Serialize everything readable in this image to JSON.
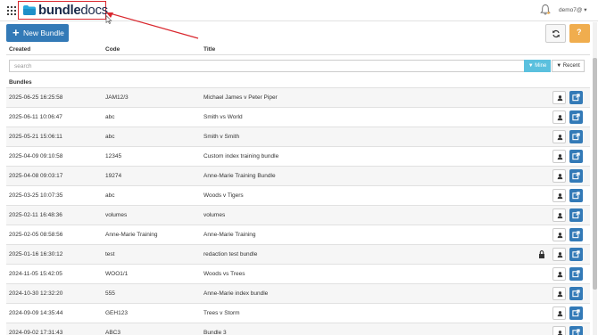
{
  "header": {
    "logo_bold": "bundle",
    "logo_light": "docs",
    "user": "demo7@ ▾"
  },
  "toolbar": {
    "new_bundle_label": "New Bundle",
    "new_bundle_icon": "plus-icon",
    "refresh_icon": "refresh-icon",
    "help_label": "?"
  },
  "columns": {
    "created": "Created",
    "code": "Code",
    "title": "Title"
  },
  "search": {
    "placeholder": "search",
    "value": "",
    "mine_label": "▼ Mine",
    "recent_label": "▼ Recent"
  },
  "section_label": "Bundles",
  "colors": {
    "primary": "#337ab7",
    "info": "#5bc0de",
    "warning": "#f0ad4e",
    "highlight": "#d9272e"
  },
  "bundles": [
    {
      "created": "2025-06-25 16:25:58",
      "code": "JAM12/3",
      "title": "Michael James v Peter Piper",
      "locked": false
    },
    {
      "created": "2025-06-11 10:06:47",
      "code": "abc",
      "title": "Smith vs World",
      "locked": false
    },
    {
      "created": "2025-05-21 15:06:11",
      "code": "abc",
      "title": "Smith v Smith",
      "locked": false
    },
    {
      "created": "2025-04-09 09:10:58",
      "code": "12345",
      "title": "Custom index training bundle",
      "locked": false
    },
    {
      "created": "2025-04-08 09:03:17",
      "code": "19274",
      "title": "Anne-Marie Training Bundle",
      "locked": false
    },
    {
      "created": "2025-03-25 10:07:35",
      "code": "abc",
      "title": "Woods v Tigers",
      "locked": false
    },
    {
      "created": "2025-02-11 16:48:36",
      "code": "volumes",
      "title": "volumes",
      "locked": false
    },
    {
      "created": "2025-02-05 08:58:56",
      "code": "Anne-Marie Training",
      "title": "Anne-Marie Training",
      "locked": false
    },
    {
      "created": "2025-01-16 16:30:12",
      "code": "test",
      "title": "redaction test bundle",
      "locked": true
    },
    {
      "created": "2024-11-05 15:42:05",
      "code": "WOO1/1",
      "title": "Woods vs Trees",
      "locked": false
    },
    {
      "created": "2024-10-30 12:32:20",
      "code": "555",
      "title": "Anne-Marie index bundle",
      "locked": false
    },
    {
      "created": "2024-09-09 14:35:44",
      "code": "GEH123",
      "title": "Trees v Storm",
      "locked": false
    },
    {
      "created": "2024-09-02 17:31:43",
      "code": "ABC3",
      "title": "Bundle 3",
      "locked": false
    }
  ]
}
